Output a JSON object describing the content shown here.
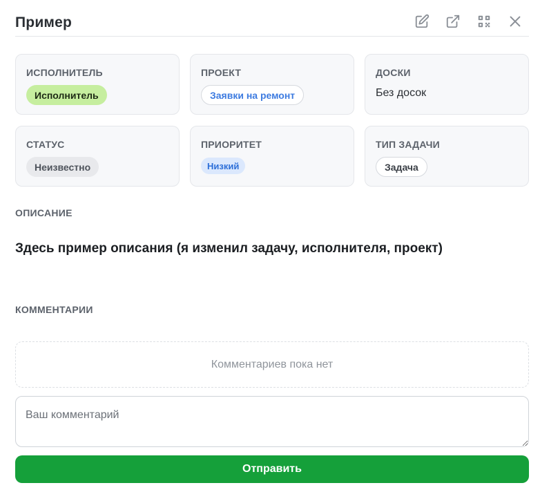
{
  "header": {
    "title": "Пример",
    "icons": [
      "edit-icon",
      "external-link-icon",
      "qr-code-icon",
      "close-icon"
    ]
  },
  "cards": {
    "assignee": {
      "label": "ИСПОЛНИТЕЛЬ",
      "value": "Исполнитель"
    },
    "project": {
      "label": "ПРОЕКТ",
      "value": "Заявки на ремонт"
    },
    "boards": {
      "label": "ДОСКИ",
      "value": "Без досок"
    },
    "status": {
      "label": "СТАТУС",
      "value": "Неизвестно"
    },
    "priority": {
      "label": "ПРИОРИТЕТ",
      "value": "Низкий"
    },
    "task_type": {
      "label": "ТИП ЗАДАЧИ",
      "value": "Задача"
    }
  },
  "description": {
    "label": "ОПИСАНИЕ",
    "text": "Здесь пример описания (я изменил задачу, исполнителя, проект)"
  },
  "comments": {
    "label": "КОММЕНТАРИИ",
    "empty_text": "Комментариев пока нет",
    "placeholder": "Ваш комментарий",
    "value": "",
    "send_label": "Отправить"
  },
  "colors": {
    "accent_green": "#15a03a",
    "assignee_pill": "#c6ee9f",
    "priority_pill": "#dbe8fd",
    "project_text": "#3d7be0"
  }
}
